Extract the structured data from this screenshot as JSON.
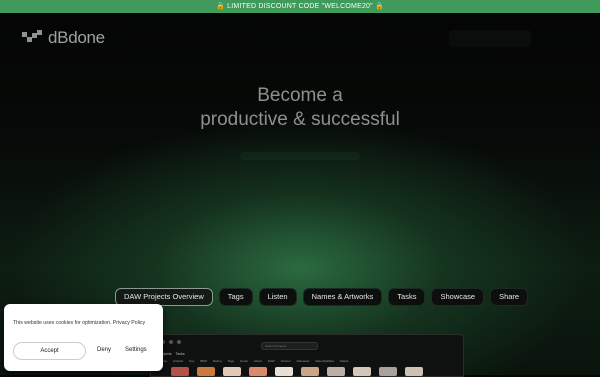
{
  "banner": {
    "text": "🔒 LIMITED DISCOUNT CODE \"WELCOME20\" 🔒"
  },
  "brand": {
    "name": "dBdone",
    "accent": "#3f9a5c",
    "icon": "dbdone-logo-icon"
  },
  "hero": {
    "line1": "Become a",
    "line2": "productive & successful"
  },
  "feature_tabs": [
    {
      "label": "DAW Projects Overview",
      "active": true
    },
    {
      "label": "Tags",
      "active": false
    },
    {
      "label": "Listen",
      "active": false
    },
    {
      "label": "Names & Artworks",
      "active": false
    },
    {
      "label": "Tasks",
      "active": false
    },
    {
      "label": "Showcase",
      "active": false
    },
    {
      "label": "Share",
      "active": false
    }
  ],
  "preview": {
    "search_placeholder": "Search Projects",
    "tabs": [
      "Projects",
      "Tasks"
    ],
    "columns": [
      "Name",
      "Artwork",
      "Key",
      "BPM",
      "Rating",
      "Tags",
      "Genre",
      "Mood",
      "DAW",
      "Version",
      "Released",
      "Date Modified",
      "Status"
    ]
  },
  "cookie": {
    "message": "This website uses cookies for optimization.",
    "policy_link": "Privacy Policy",
    "accept": "Accept",
    "deny": "Deny",
    "settings": "Settings"
  }
}
